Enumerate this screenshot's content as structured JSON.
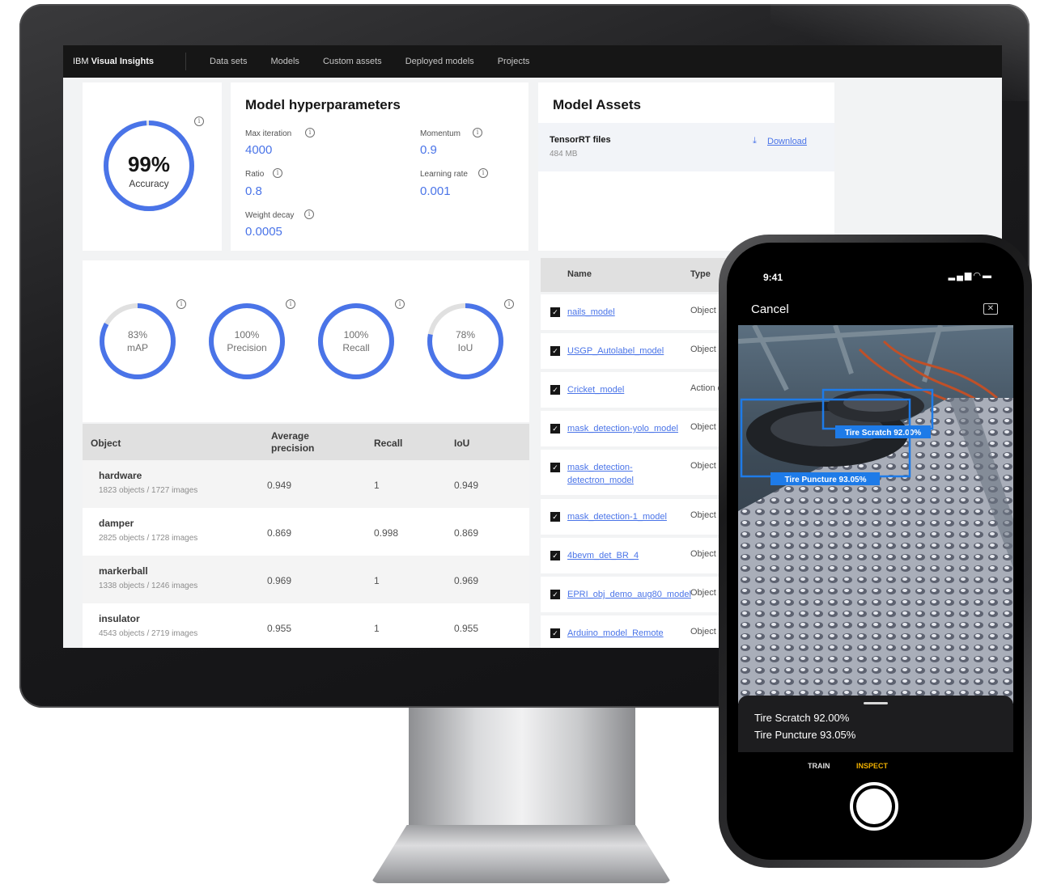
{
  "nav": {
    "brand_prefix": "IBM",
    "brand_name": "Visual Insights",
    "items": [
      "Data sets",
      "Models",
      "Custom assets",
      "Deployed models",
      "Projects"
    ]
  },
  "accuracy": {
    "value_text": "99%",
    "label": "Accuracy",
    "fraction": 0.99
  },
  "hyperparameters": {
    "title": "Model hyperparameters",
    "max_iteration": {
      "label": "Max iteration",
      "value": "4000"
    },
    "momentum": {
      "label": "Momentum",
      "value": "0.9"
    },
    "ratio": {
      "label": "Ratio",
      "value": "0.8"
    },
    "learning_rate": {
      "label": "Learning rate",
      "value": "0.001"
    },
    "weight_decay": {
      "label": "Weight decay",
      "value": "0.0005"
    }
  },
  "assets": {
    "title": "Model Assets",
    "file_name": "TensorRT files",
    "file_size": "484 MB",
    "download_label": "Download"
  },
  "metrics": [
    {
      "value_text": "83%",
      "label": "mAP",
      "fraction": 0.83
    },
    {
      "value_text": "100%",
      "label": "Precision",
      "fraction": 1.0
    },
    {
      "value_text": "100%",
      "label": "Recall",
      "fraction": 1.0
    },
    {
      "value_text": "78%",
      "label": "IoU",
      "fraction": 0.78
    }
  ],
  "metrics_table": {
    "headers": {
      "object": "Object",
      "avg_precision": "Average precision",
      "recall": "Recall",
      "iou": "IoU"
    },
    "rows": [
      {
        "object": "hardware",
        "sub": "1823 objects / 1727 images",
        "ap": "0.949",
        "recall": "1",
        "iou": "0.949"
      },
      {
        "object": "damper",
        "sub": "2825 objects / 1728 images",
        "ap": "0.869",
        "recall": "0.998",
        "iou": "0.869"
      },
      {
        "object": "markerball",
        "sub": "1338 objects / 1246 images",
        "ap": "0.969",
        "recall": "1",
        "iou": "0.969"
      },
      {
        "object": "insulator",
        "sub": "4543 objects / 2719 images",
        "ap": "0.955",
        "recall": "1",
        "iou": "0.955"
      }
    ]
  },
  "models_list": {
    "headers": {
      "name": "Name",
      "type": "Type"
    },
    "rows": [
      {
        "name": "nails_model",
        "type": "Object d"
      },
      {
        "name": "USGP_Autolabel_model",
        "type": "Object d"
      },
      {
        "name": "Cricket_model",
        "type": "Action d"
      },
      {
        "name": "mask_detection-yolo_model",
        "type": "Object d"
      },
      {
        "name": "mask_detection-detectron_model",
        "type": "Object d"
      },
      {
        "name": "mask_detection-1_model",
        "type": "Object d"
      },
      {
        "name": "4bevm_det_BR_4",
        "type": "Object d"
      },
      {
        "name": "EPRI_obj_demo_aug80_model",
        "type": "Object d"
      },
      {
        "name": "Arduino_model_Remote",
        "type": "Object d"
      }
    ]
  },
  "phone": {
    "time": "9:41",
    "cancel_label": "Cancel",
    "box_labels": [
      "Tire Scratch 92.00%",
      "Tire Puncture 93.05%"
    ],
    "detections": [
      "Tire Scratch 92.00%",
      "Tire Puncture 93.05%"
    ],
    "mode_train": "TRAIN",
    "mode_inspect": "INSPECT"
  },
  "colors": {
    "accent": "#4a74e8",
    "detection_box": "#1e7be8",
    "inspect": "#f0b000"
  }
}
